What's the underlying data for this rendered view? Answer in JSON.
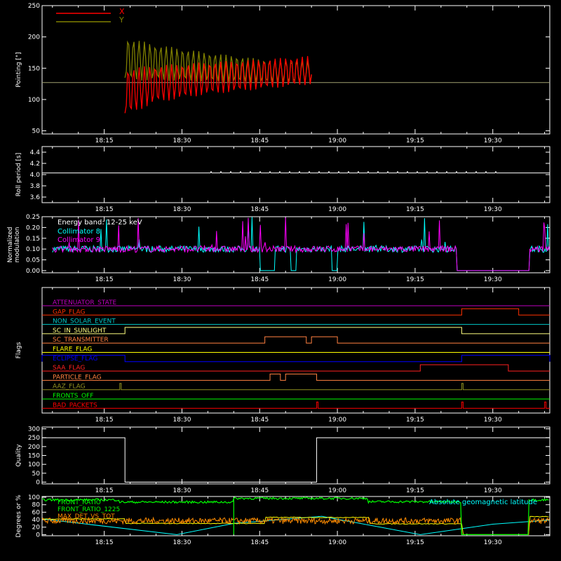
{
  "time_ticks": [
    "18:15",
    "18:30",
    "18:45",
    "19:00",
    "19:15",
    "19:30"
  ],
  "colors": {
    "background": "#000000",
    "axes": "#ffffff",
    "x": "#ff0000",
    "y": "#808000",
    "collimator8": "#00ffff",
    "collimator9": "#ff00ff",
    "green": "#00ff00",
    "orange": "#ff8c00",
    "yellow": "#ffff00",
    "cyan": "#00ffff"
  },
  "chart_data": [
    {
      "id": "pointing",
      "type": "line",
      "ylabel": "Pointing [\"]",
      "yticks": [
        "50",
        "100",
        "150",
        "200",
        "250"
      ],
      "ylim": [
        45,
        250
      ],
      "time_range": [
        "18:03",
        "19:41"
      ],
      "legend": {
        "placement": "top-left",
        "entries": [
          {
            "label": "X",
            "color": "#ff0000"
          },
          {
            "label": "Y",
            "color": "#808000"
          }
        ]
      },
      "series": [
        {
          "name": "X",
          "color": "#ff0000",
          "envelope": [
            {
              "t": "18:19",
              "upper": 150,
              "lower": 73
            },
            {
              "t": "18:25",
              "upper": 155,
              "lower": 95
            },
            {
              "t": "18:35",
              "upper": 160,
              "lower": 108
            },
            {
              "t": "18:45",
              "upper": 164,
              "lower": 116
            },
            {
              "t": "18:55",
              "upper": 170,
              "lower": 124
            }
          ]
        },
        {
          "name": "Y",
          "color": "#808000",
          "envelope": [
            {
              "t": "18:19",
              "upper": 200,
              "lower": 130
            },
            {
              "t": "18:25",
              "upper": 188,
              "lower": 130
            },
            {
              "t": "18:35",
              "upper": 175,
              "lower": 128
            },
            {
              "t": "18:45",
              "upper": 165,
              "lower": 127
            },
            {
              "t": "18:55",
              "upper": 162,
              "lower": 126
            }
          ]
        }
      ],
      "reference_line": {
        "value": 127
      }
    },
    {
      "id": "roll_period",
      "type": "line",
      "ylabel": "Roll period [s]",
      "yticks": [
        "3.6",
        "3.8",
        "4.0",
        "4.2",
        "4.4"
      ],
      "ylim": [
        3.5,
        4.5
      ],
      "series": [
        {
          "value": 4.03,
          "start": "18:03",
          "end": "19:41",
          "color": "#ffffff"
        }
      ]
    },
    {
      "id": "modulation",
      "type": "line",
      "ylabel": [
        "Normalized",
        "modulation"
      ],
      "yticks": [
        "0.00",
        "0.05",
        "0.10",
        "0.15",
        "0.20",
        "0.25"
      ],
      "ylim": [
        -0.01,
        0.25
      ],
      "annotation": "Energy band: 12-25 keV",
      "legend": {
        "placement": "top-left",
        "entries": [
          {
            "label": "Collimator 8",
            "color": "#00ffff"
          },
          {
            "label": "Collimator 9",
            "color": "#ff00ff"
          }
        ]
      },
      "series": [
        {
          "name": "Collimator 8",
          "color": "#00ffff",
          "typical": 0.1,
          "gaps": [
            [
              "18:45",
              "18:48"
            ],
            [
              "18:51",
              "18:52"
            ],
            [
              "18:59",
              "19:00"
            ],
            [
              "19:23",
              "19:37"
            ]
          ]
        },
        {
          "name": "Collimator 9",
          "color": "#ff00ff",
          "typical": 0.1,
          "gaps": [
            [
              "19:23",
              "19:37"
            ]
          ]
        }
      ]
    },
    {
      "id": "flags",
      "type": "line",
      "ylabel": "Flags",
      "flags": [
        {
          "label": "ATTENUATOR_STATE",
          "color": "#c000c0",
          "high": []
        },
        {
          "label": "GAP_FLAG",
          "color": "#ff3000",
          "high": [
            [
              "19:24",
              "19:35"
            ]
          ]
        },
        {
          "label": "NON_SOLAR_EVENT",
          "color": "#00c8c8",
          "high": []
        },
        {
          "label": "SC_IN_SUNLIGHT",
          "color": "#ffff80",
          "high": [
            [
              "18:19",
              "19:24"
            ]
          ]
        },
        {
          "label": "SC_TRANSMITTER",
          "color": "#ff8040",
          "high": [
            [
              "18:46",
              "18:54"
            ],
            [
              "18:55",
              "19:00"
            ]
          ]
        },
        {
          "label": "FLARE_FLAG",
          "color": "#ffff00",
          "high": []
        },
        {
          "label": "ECLIPSE_FLAG",
          "color": "#0000ff",
          "high": [
            [
              "18:03",
              "18:19"
            ],
            [
              "19:24",
              "19:41"
            ]
          ]
        },
        {
          "label": "SAA_FLAG",
          "color": "#ff2020",
          "high": [
            [
              "19:16",
              "19:33"
            ]
          ]
        },
        {
          "label": "PARTICLE_FLAG",
          "color": "#ff8040",
          "high": [
            [
              "18:47",
              "18:49"
            ],
            [
              "18:50",
              "18:56"
            ]
          ]
        },
        {
          "label": "AAZ_FLAG",
          "color": "#909020",
          "high": [
            [
              "18:18",
              "18:18"
            ],
            [
              "19:24",
              "19:24"
            ]
          ]
        },
        {
          "label": "FRONTS_OFF",
          "color": "#00ff00",
          "high": []
        },
        {
          "label": "BAD_PACKETS",
          "color": "#ff0000",
          "high": [
            [
              "18:56",
              "18:56"
            ],
            [
              "19:24",
              "19:24"
            ],
            [
              "19:40",
              "19:40"
            ]
          ]
        }
      ]
    },
    {
      "id": "quality",
      "type": "line",
      "ylabel": "Quality",
      "yticks": [
        "0",
        "50",
        "100",
        "150",
        "200",
        "250",
        "300"
      ],
      "ylim": [
        -10,
        310
      ],
      "series": [
        {
          "color": "#ffffff",
          "segments": [
            {
              "start": "18:03",
              "end": "18:19",
              "value": 250
            },
            {
              "start": "18:19",
              "end": "18:56",
              "value": 0
            },
            {
              "start": "18:56",
              "end": "19:41",
              "value": 250
            }
          ]
        }
      ]
    },
    {
      "id": "ratios",
      "type": "line",
      "ylabel": "Degrees or %",
      "yticks": [
        "0",
        "20",
        "40",
        "60",
        "80",
        "100"
      ],
      "ylim": [
        -3,
        102
      ],
      "legend": {
        "placement": "top-left",
        "entries": [
          {
            "label": "FRONT_RATIO",
            "color": "#00ff00"
          },
          {
            "label": "FRONT_RATIO_1225",
            "color": "#00ff00"
          },
          {
            "label": "MAX_DET_VS_TOT",
            "color": "#ff8c00"
          }
        ]
      },
      "annotation": "Absolute geomagnetic latitude",
      "series": [
        {
          "name": "FRONT_RATIO",
          "color": "#00ff00",
          "levels": [
            {
              "start": "18:03",
              "end": "18:18",
              "value": 93
            },
            {
              "start": "18:18",
              "end": "18:40",
              "value": 87
            },
            {
              "start": "18:40",
              "end": "19:06",
              "value": 97
            },
            {
              "start": "19:06",
              "end": "19:24",
              "value": 88
            },
            {
              "start": "19:24",
              "end": "19:37",
              "value": 0
            },
            {
              "start": "19:37",
              "end": "19:41",
              "value": 93
            }
          ]
        },
        {
          "name": "MAX_DET_VS_TOT",
          "color": "#ff8c00",
          "typical": 37
        },
        {
          "name": "yellow",
          "color": "#ffff00",
          "levels": [
            {
              "start": "18:03",
              "end": "18:19",
              "value": 42
            },
            {
              "start": "18:19",
              "end": "18:46",
              "value": 30
            },
            {
              "start": "18:46",
              "end": "19:06",
              "value": 46
            },
            {
              "start": "19:06",
              "end": "19:24",
              "value": 29
            },
            {
              "start": "19:24",
              "end": "19:37",
              "value": 0
            },
            {
              "start": "19:37",
              "end": "19:41",
              "value": 48
            }
          ]
        },
        {
          "name": "Absolute geomagnetic latitude",
          "color": "#00ffff",
          "points": [
            [
              "18:03",
              42
            ],
            [
              "18:29",
              0
            ],
            [
              "18:40",
              30
            ],
            [
              "18:57",
              49
            ],
            [
              "19:16",
              0
            ],
            [
              "19:30",
              28
            ],
            [
              "19:41",
              39
            ]
          ]
        }
      ]
    }
  ]
}
